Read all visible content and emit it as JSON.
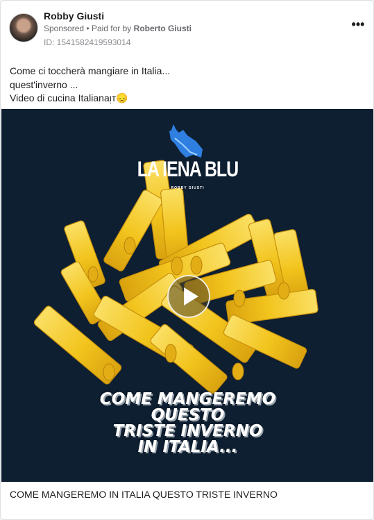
{
  "post": {
    "advertiser_name": "Robby Giusti",
    "sponsored_label": "Sponsored",
    "separator": "•",
    "paid_for_prefix": "Paid for by",
    "paid_for_name": "Roberto Giusti",
    "ad_id": "ID: 1541582419593014",
    "more_options_glyph": "•••",
    "avatar_icon": "profile-photo"
  },
  "caption": {
    "line1": "Come ci toccherà mangiare in Italia...",
    "line2": "quest'inverno ...",
    "line3_text": "Video di cucina Italianaᴉᴛ",
    "line3_emoji": "😞"
  },
  "media": {
    "brand_title": "LA IENA BLU",
    "brand_subtitle": "ROBBY GIUSTI",
    "brand_icon": "blue-hyena-logo",
    "play_icon": "play-icon",
    "headline": [
      "COME MANGEREMO",
      "QUESTO",
      "TRISTE INVERNO",
      "IN ITALIA..."
    ],
    "background_color": "#0e1f31",
    "pasta_color": "#f2c41d"
  },
  "footer": {
    "title": "COME MANGEREMO IN ITALIA QUESTO TRISTE INVERNO"
  }
}
